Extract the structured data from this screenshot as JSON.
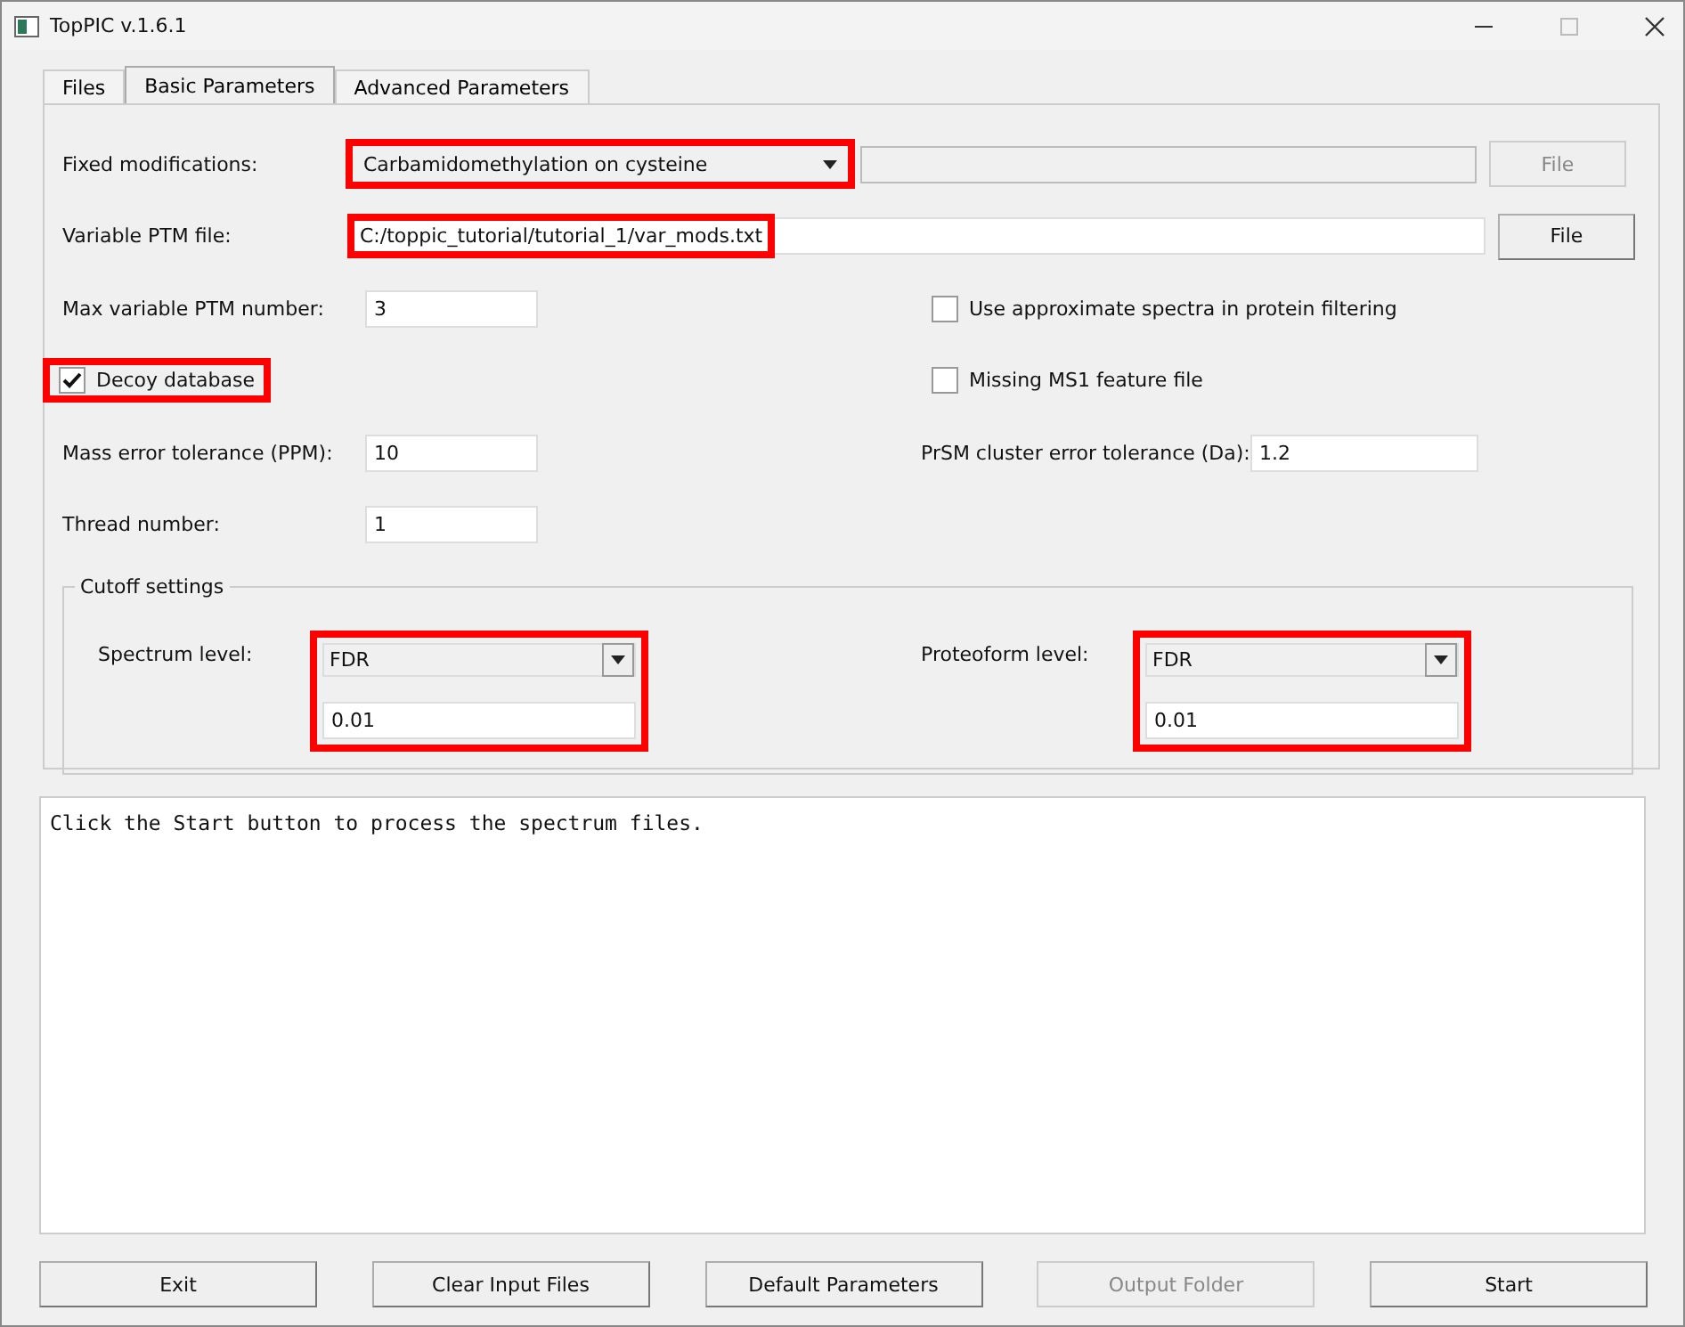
{
  "window": {
    "title": "TopPIC v.1.6.1"
  },
  "tabs": [
    {
      "label": "Files",
      "selected": false
    },
    {
      "label": "Basic Parameters",
      "selected": true
    },
    {
      "label": "Advanced Parameters",
      "selected": false
    }
  ],
  "fixed_modifications": {
    "label": "Fixed modifications:",
    "value": "Carbamidomethylation on cysteine",
    "highlighted": true,
    "file_button": {
      "label": "File",
      "disabled": true
    }
  },
  "variable_ptm_file": {
    "label": "Variable PTM file:",
    "value": "C:/toppic_tutorial/tutorial_1/var_mods.txt",
    "highlighted": true,
    "file_button": {
      "label": "File",
      "disabled": false
    }
  },
  "max_variable_ptm": {
    "label": "Max variable PTM number:",
    "value": "3"
  },
  "use_approximate_spectra": {
    "label": "Use approximate spectra in protein filtering",
    "checked": false
  },
  "decoy_database": {
    "label": "Decoy database",
    "checked": true,
    "highlighted": true
  },
  "missing_ms1": {
    "label": "Missing MS1 feature file",
    "checked": false
  },
  "mass_error_tolerance": {
    "label": "Mass error tolerance (PPM):",
    "value": "10"
  },
  "prsm_cluster_error": {
    "label": "PrSM cluster error tolerance (Da):",
    "value": "1.2"
  },
  "thread_number": {
    "label": "Thread number:",
    "value": "1"
  },
  "cutoff_settings": {
    "title": "Cutoff settings",
    "levels": [
      {
        "label": "Spectrum level:",
        "type": "FDR",
        "value": "0.01",
        "highlighted": true
      },
      {
        "label": "Proteoform level:",
        "type": "FDR",
        "value": "0.01",
        "highlighted": true
      }
    ]
  },
  "log": "Click the Start button to process the spectrum files.",
  "buttons": [
    {
      "label": "Exit",
      "disabled": false
    },
    {
      "label": "Clear Input Files",
      "disabled": false
    },
    {
      "label": "Default Parameters",
      "disabled": false
    },
    {
      "label": "Output Folder",
      "disabled": true
    },
    {
      "label": "Start",
      "disabled": false
    }
  ]
}
